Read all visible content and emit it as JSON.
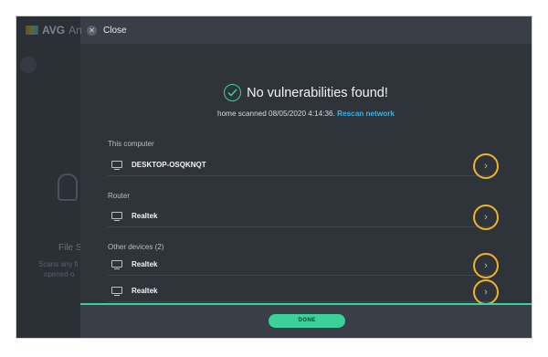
{
  "background_app": {
    "logo": "AVG",
    "product_partial": "An",
    "card_title": "File S",
    "card_desc_line1": "Scans any fi",
    "card_desc_line2": "opened o"
  },
  "close": {
    "label": "Close"
  },
  "result": {
    "title": "No vulnerabilities found!",
    "scan_text": "home scanned 08/05/2020 4:14:36.",
    "rescan_label": "Rescan network"
  },
  "sections": [
    {
      "label": "This computer",
      "devices": [
        "DESKTOP-OSQKNQT"
      ]
    },
    {
      "label": "Router",
      "devices": [
        "Realtek"
      ]
    },
    {
      "label": "Other devices (2)",
      "devices": [
        "Realtek",
        "Realtek"
      ]
    }
  ],
  "footer": {
    "done_label": "DONE"
  },
  "colors": {
    "accent_green": "#3bd19a",
    "highlight_ring": "#f0b323",
    "link_blue": "#33b5e5"
  }
}
